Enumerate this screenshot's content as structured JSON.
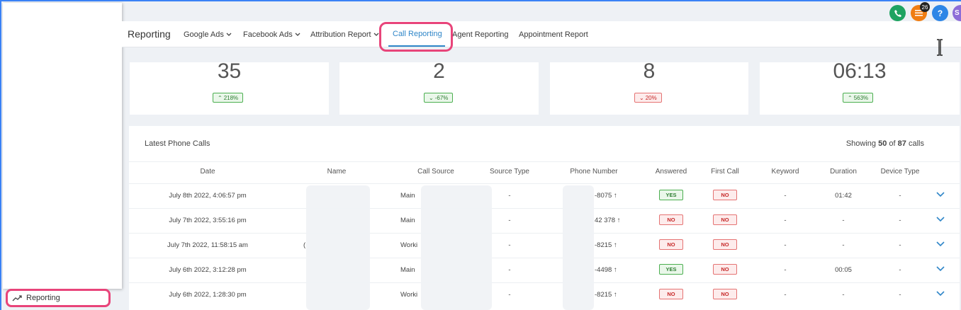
{
  "header": {
    "title": "Reporting",
    "nav": [
      {
        "label": "Google Ads",
        "dropdown": true
      },
      {
        "label": "Facebook Ads",
        "dropdown": true
      },
      {
        "label": "Attribution Report",
        "dropdown": true
      },
      {
        "label": "Call Reporting",
        "dropdown": false,
        "active": true
      },
      {
        "label": "Agent Reporting",
        "dropdown": false
      },
      {
        "label": "Appointment Report",
        "dropdown": false
      }
    ],
    "notification_count": "26",
    "help_label": "?",
    "avatar_initial": "S"
  },
  "sidebar": {
    "reporting_label": "Reporting"
  },
  "stats": [
    {
      "value": "35",
      "change": "218%",
      "direction": "up"
    },
    {
      "value": "2",
      "change": "-67%",
      "direction": "down"
    },
    {
      "value": "8",
      "change": "20%",
      "direction": "down"
    },
    {
      "value": "06:13",
      "change": "563%",
      "direction": "up"
    }
  ],
  "calls": {
    "title": "Latest Phone Calls",
    "showing_prefix": "Showing",
    "showing_count": "50",
    "showing_of": "of",
    "showing_total": "87",
    "showing_suffix": "calls",
    "columns": [
      "Date",
      "Name",
      "Call Source",
      "Source Type",
      "Phone Number",
      "Answered",
      "First Call",
      "Keyword",
      "Duration",
      "Device Type"
    ],
    "rows": [
      {
        "date": "July 8th 2022, 4:06:57 pm",
        "name": "",
        "call_source": "Main",
        "source_type": "-",
        "phone": "-8075",
        "answered": "YES",
        "first_call": "NO",
        "keyword": "-",
        "duration": "01:42",
        "device_type": "-"
      },
      {
        "date": "July 7th 2022, 3:55:16 pm",
        "name": "",
        "call_source": "Main",
        "source_type": "-",
        "phone": "42 378",
        "answered": "NO",
        "first_call": "NO",
        "keyword": "-",
        "duration": "-",
        "device_type": "-"
      },
      {
        "date": "July 7th 2022, 11:58:15 am",
        "name": "(",
        "call_source": "Worki",
        "source_type": "-",
        "phone": "-8215",
        "answered": "NO",
        "first_call": "NO",
        "keyword": "-",
        "duration": "-",
        "device_type": "-"
      },
      {
        "date": "July 6th 2022, 3:12:28 pm",
        "name": "",
        "call_source": "Main",
        "source_type": "-",
        "phone": "-4498",
        "answered": "YES",
        "first_call": "NO",
        "keyword": "-",
        "duration": "00:05",
        "device_type": "-"
      },
      {
        "date": "July 6th 2022, 1:28:30 pm",
        "name": "",
        "call_source": "Worki",
        "source_type": "-",
        "phone": "-8215",
        "answered": "NO",
        "first_call": "NO",
        "keyword": "-",
        "duration": "-",
        "device_type": "-"
      }
    ]
  },
  "colors": {
    "accent": "#2f86c8",
    "highlight_ring": "#e8447a",
    "phone_icon_bg": "#1ea361",
    "notification_bg": "#f07d12",
    "help_bg": "#2e86e6",
    "avatar_bg": "#8c6dd8"
  },
  "icons": {
    "sidebar": "trending-up-icon",
    "phone": "phone-icon",
    "notifications": "list-icon",
    "help": "help-icon",
    "row_expand": "chevron-down-icon",
    "phone_arrow": "arrow-up-icon"
  }
}
